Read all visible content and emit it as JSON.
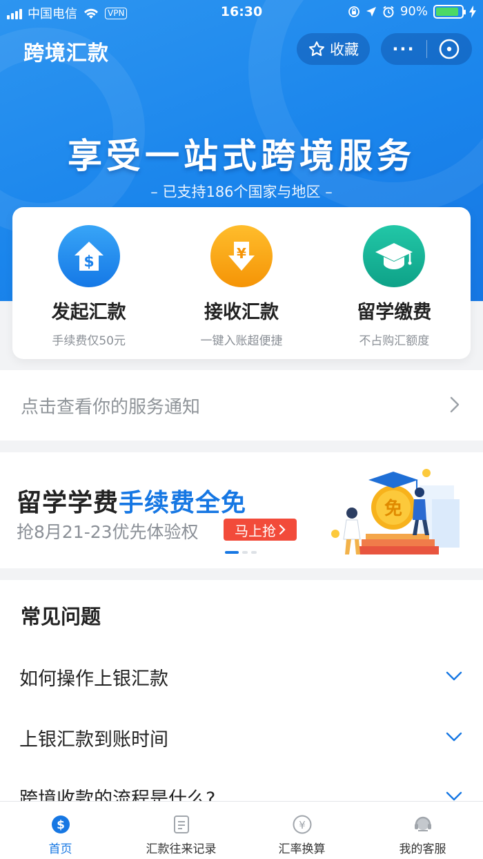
{
  "status_bar": {
    "carrier": "中国电信",
    "vpn": "VPN",
    "time": "16:30",
    "battery": "90%",
    "battery_level": 0.9
  },
  "header": {
    "title": "跨境汇款",
    "favorite_label": "收藏",
    "more_label": "···"
  },
  "banner": {
    "title": "享受一站式跨境服务",
    "subtitle": "– 已支持186个国家与地区 –"
  },
  "services": [
    {
      "name": "发起汇款",
      "desc": "手续费仅50元",
      "icon": "dollar-house-icon",
      "color": "#1b82ec"
    },
    {
      "name": "接收汇款",
      "desc": "一键入账超便捷",
      "icon": "yuan-down-arrow-icon",
      "color": "#f7a212"
    },
    {
      "name": "留学缴费",
      "desc": "不占购汇额度",
      "icon": "graduation-cap-icon",
      "color": "#12b096"
    }
  ],
  "notice": {
    "text": "点击查看你的服务通知"
  },
  "promo": {
    "title_main": "留学学费",
    "title_highlight": "手续费全免",
    "subtitle": "抢8月21-23优先体验权",
    "cta": "马上抢",
    "badge_char": "免",
    "active_slide": 1,
    "slide_count": 3
  },
  "faq": {
    "heading": "常见问题",
    "items": [
      {
        "question": "如何操作上银汇款"
      },
      {
        "question": "上银汇款到账时间"
      },
      {
        "question": "跨境收款的流程是什么?"
      }
    ]
  },
  "tabbar": {
    "tabs": [
      {
        "label": "首页",
        "icon": "dollar-circle-icon",
        "active": true
      },
      {
        "label": "汇款往来记录",
        "icon": "document-icon",
        "active": false
      },
      {
        "label": "汇率换算",
        "icon": "yuan-circle-icon",
        "active": false
      },
      {
        "label": "我的客服",
        "icon": "headset-icon",
        "active": false
      }
    ]
  },
  "colors": {
    "primary": "#1677e3",
    "accent_red": "#f24b3a",
    "battery_green": "#4cd964"
  }
}
